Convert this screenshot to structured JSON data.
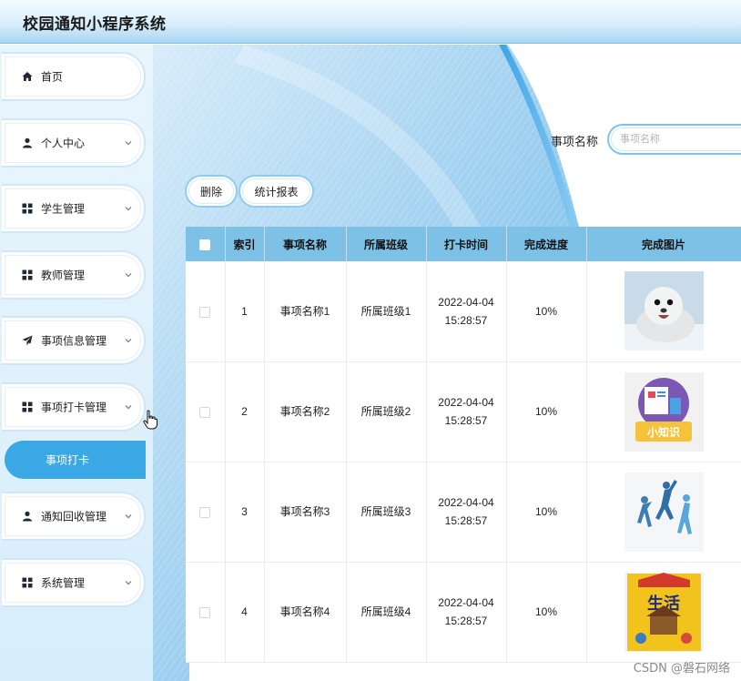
{
  "app": {
    "title": "校园通知小程序系统"
  },
  "colors": {
    "accent": "#3aa8e4",
    "header_row": "#7ec1e6",
    "sidebar_bg": "#e0f0fb"
  },
  "sidebar": {
    "items": [
      {
        "label": "首页",
        "icon": "home-icon",
        "expandable": false
      },
      {
        "label": "个人中心",
        "icon": "user-icon",
        "expandable": true
      },
      {
        "label": "学生管理",
        "icon": "grid-icon",
        "expandable": true
      },
      {
        "label": "教师管理",
        "icon": "grid-icon",
        "expandable": true
      },
      {
        "label": "事项信息管理",
        "icon": "send-icon",
        "expandable": true
      },
      {
        "label": "事项打卡管理",
        "icon": "grid-icon",
        "expandable": true,
        "expanded": true
      },
      {
        "label": "通知回收管理",
        "icon": "user-icon",
        "expandable": true
      },
      {
        "label": "系统管理",
        "icon": "grid-icon",
        "expandable": true
      }
    ],
    "active_subitem": "事项打卡"
  },
  "search": {
    "label": "事项名称",
    "placeholder": "事项名称",
    "value": ""
  },
  "toolbar": {
    "delete_label": "删除",
    "report_label": "统计报表"
  },
  "table": {
    "columns": [
      "",
      "索引",
      "事项名称",
      "所属班级",
      "打卡时间",
      "完成进度",
      "完成图片"
    ],
    "rows": [
      {
        "index": "1",
        "name": "事项名称1",
        "class": "所属班级1",
        "date": "2022-04-04",
        "time": "15:28:57",
        "progress": "10%",
        "image": "seal-photo"
      },
      {
        "index": "2",
        "name": "事项名称2",
        "class": "所属班级2",
        "date": "2022-04-04",
        "time": "15:28:57",
        "progress": "10%",
        "image": "knowledge-poster"
      },
      {
        "index": "3",
        "name": "事项名称3",
        "class": "所属班级3",
        "date": "2022-04-04",
        "time": "15:28:57",
        "progress": "10%",
        "image": "sports-silhouettes"
      },
      {
        "index": "4",
        "name": "事项名称4",
        "class": "所属班级4",
        "date": "2022-04-04",
        "time": "15:28:57",
        "progress": "10%",
        "image": "life-book-cover"
      }
    ]
  },
  "watermark": "CSDN @磐石网络"
}
